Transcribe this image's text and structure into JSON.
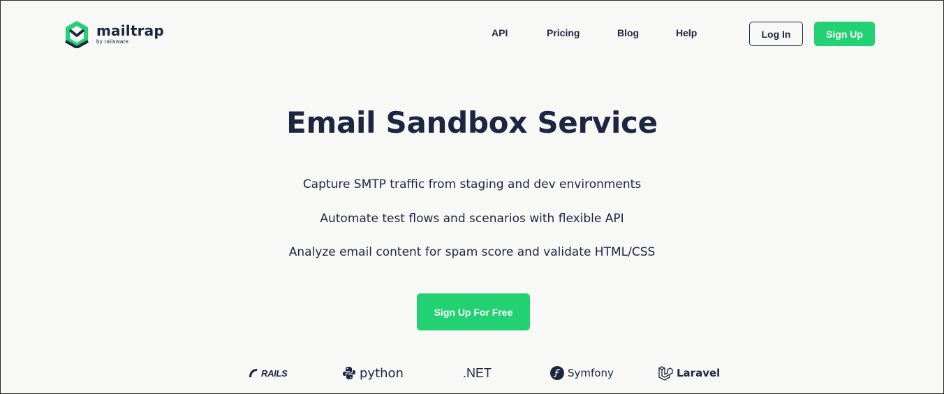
{
  "brand": {
    "name": "mailtrap",
    "tagline": "by railsware",
    "accent": "#22d172",
    "text_color": "#1d2640"
  },
  "nav": {
    "items": [
      {
        "label": "API"
      },
      {
        "label": "Pricing"
      },
      {
        "label": "Blog"
      },
      {
        "label": "Help"
      }
    ],
    "login_label": "Log In",
    "signup_label": "Sign Up"
  },
  "hero": {
    "title": "Email Sandbox Service",
    "features": [
      "Capture SMTP traffic from staging and dev environments",
      "Automate test flows and scenarios with flexible API",
      "Analyze email content for spam score and validate HTML/CSS"
    ],
    "cta_label": "Sign Up For Free"
  },
  "frameworks": [
    {
      "name": "RAILS",
      "icon": "rails-icon"
    },
    {
      "name": "python",
      "icon": "python-icon"
    },
    {
      "name": ".NET",
      "icon": ""
    },
    {
      "name": "Symfony",
      "icon": "symfony-icon"
    },
    {
      "name": "Laravel",
      "icon": "laravel-icon"
    }
  ]
}
